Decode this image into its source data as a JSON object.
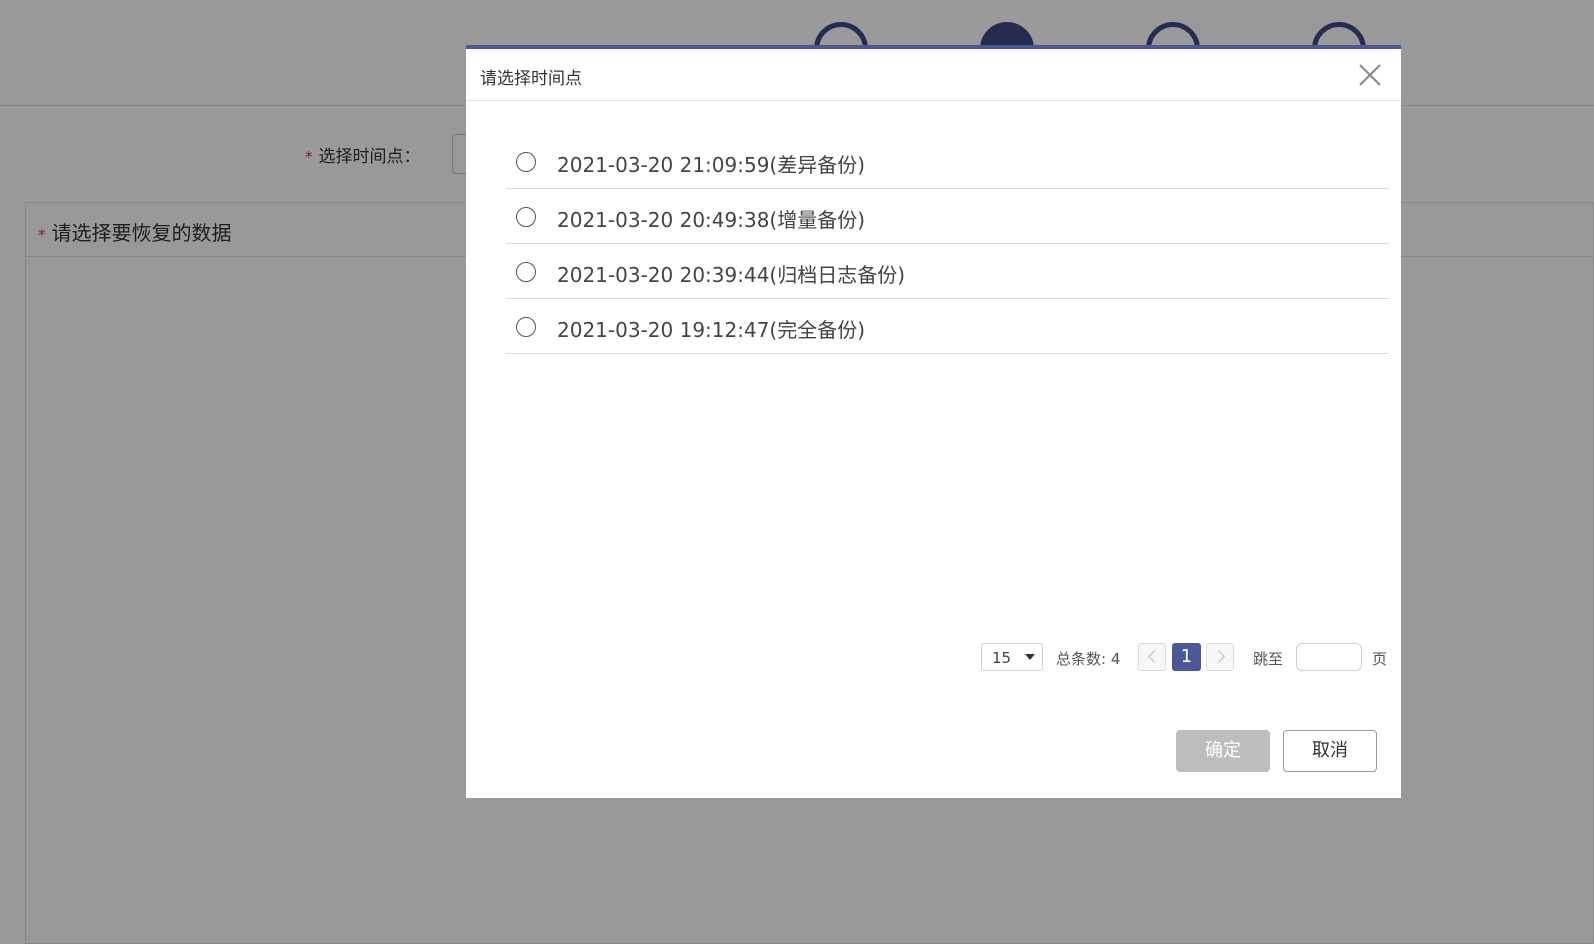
{
  "background": {
    "field_label": "选择时间点：",
    "required_mark": "*",
    "data_panel_title": "请选择要恢复的数据"
  },
  "modal": {
    "title": "请选择时间点",
    "items": [
      {
        "label": "2021-03-20 21:09:59(差异备份)"
      },
      {
        "label": "2021-03-20 20:49:38(增量备份)"
      },
      {
        "label": "2021-03-20 20:39:44(归档日志备份)"
      },
      {
        "label": "2021-03-20 19:12:47(完全备份)"
      }
    ],
    "pagination": {
      "page_size": "15",
      "total_label": "总条数: 4",
      "current_page": "1",
      "jump_label": "跳至",
      "jump_value": "",
      "page_unit": "页"
    },
    "confirm_label": "确定",
    "cancel_label": "取消"
  },
  "colors": {
    "accent": "#4a5899",
    "disabled_button": "#bdbdbd",
    "required": "#e03030"
  }
}
